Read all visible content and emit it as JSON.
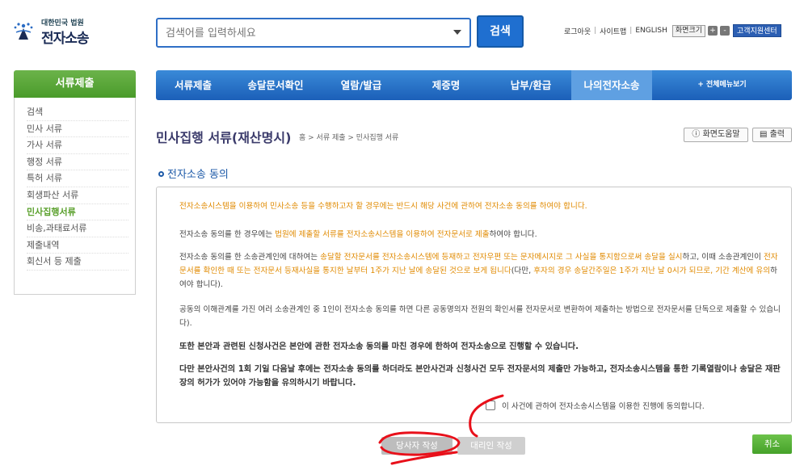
{
  "header": {
    "logo_small": "대한민국 법원",
    "logo_big": "전자소송",
    "search_placeholder": "검색어를 입력하세요",
    "search_button": "검색",
    "util_links": [
      "로그아웃",
      "사이트맵",
      "ENGLISH"
    ],
    "font_size_label": "화면크기",
    "font_plus": "+",
    "font_minus": "-",
    "customer_center": "고객지원센터"
  },
  "sidebar": {
    "title": "서류제출",
    "items": [
      {
        "label": "검색",
        "active": false
      },
      {
        "label": "민사 서류",
        "active": false
      },
      {
        "label": "가사 서류",
        "active": false
      },
      {
        "label": "행정 서류",
        "active": false
      },
      {
        "label": "특허 서류",
        "active": false
      },
      {
        "label": "회생파산 서류",
        "active": false
      },
      {
        "label": "민사집행서류",
        "active": true
      },
      {
        "label": "비송,과태료서류",
        "active": false
      },
      {
        "label": "제출내역",
        "active": false
      },
      {
        "label": "회신서 등 제출",
        "active": false
      }
    ]
  },
  "nav": {
    "items": [
      "서류제출",
      "송달문서확인",
      "열람/발급",
      "제증명",
      "납부/환급",
      "나의전자소송"
    ],
    "selected": "나의전자소송",
    "more": "+ 전체메뉴보기"
  },
  "page": {
    "title": "민사집행 서류(재산명시)",
    "breadcrumb": "홈 > 서류 제출 > 민사집행 서류",
    "help_button": "화면도움말",
    "print_button": "출력",
    "help_icon": "info-circle-icon",
    "print_icon": "printer-icon",
    "subtitle": "전자소송 동의"
  },
  "content": {
    "p1": "전자소송시스템을 이용하여 민사소송 등을 수행하고자 할 경우에는 반드시 해당 사건에 관하여 전자소송 동의를 하여야 합니다.",
    "p2_a": "전자소송 동의를 한 경우에는 ",
    "p2_b": "법원에 제출할 서류를 전자소송시스템을 이용하여 전자문서로 제출",
    "p2_c": "하여야 합니다.",
    "p3_a": "전자소송 동의를 한 소송관계인에 대하여는 ",
    "p3_b": "송달할 전자문서를 전자소송시스템에 등재하고 전자우편 또는 문자메시지로 그 사실을 통지함으로써 송달을 실시",
    "p3_c": "하고, 이때 소송관계인이 ",
    "p3_d": "전자문서를 확인한 때 또는 전자문서 등재사실을 통지한 날부터 1주가 지난 날에 송달된 것으로 보게 됩니다",
    "p3_e": "(다만, ",
    "p3_f": "후자의 경우 송달간주일은 1주가 지난 날 0시가 되므로, 기간 계산에 유의",
    "p3_g": "하여야 합니다).",
    "p4": "공동의 이해관계를 가진 여러 소송관계인 중 1인이 전자소송 동의를 하면 다른 공동명의자 전원의 확인서를 전자문서로 변환하여 제출하는 방법으로 전자문서를 단독으로 제출할 수 있습니다).",
    "p5": "또한 본안과 관련된 신청사건은 본안에 관한 전자소송 동의를 마친 경우에 한하여 전자소송으로 진행할 수 있습니다.",
    "p6": "다만 본안사건의 1회 기일 다음날 후에는 전자소송 동의를 하더라도 본안사건과 신청사건 모두 전자문서의 제출만 가능하고, 전자소송시스템을 통한 기록열람이나 송달은 재판장의 허가가 있어야 가능함을 유의하시기 바랍니다.",
    "agree_label": "이 사건에 관하여 전자소송시스템을 이용한 진행에 동의합니다."
  },
  "buttons": {
    "party": "당사자 작성",
    "agent": "대리인 작성",
    "cancel": "취소"
  },
  "colors": {
    "nav_blue": "#1b5fb8",
    "sidebar_green": "#4a9b2a",
    "highlight_orange": "#e08a00",
    "annotation_red": "#e8101a"
  }
}
